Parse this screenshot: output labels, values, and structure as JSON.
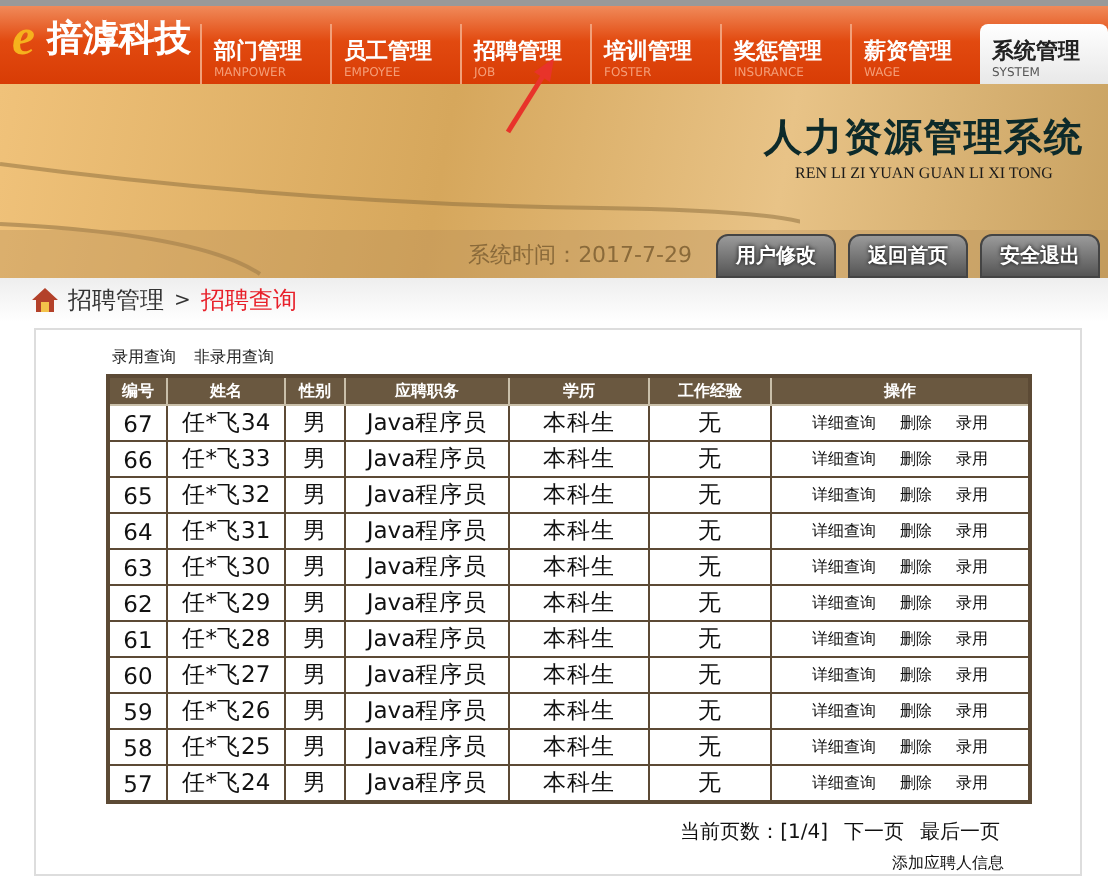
{
  "header": {
    "logo_letter": "e",
    "company": "揞滹科技",
    "nav": [
      {
        "label": "部门管理",
        "sub": "MANPOWER",
        "selected": false
      },
      {
        "label": "员工管理",
        "sub": "EMPOYEE",
        "selected": false
      },
      {
        "label": "招聘管理",
        "sub": "JOB",
        "selected": false
      },
      {
        "label": "培训管理",
        "sub": "FOSTER",
        "selected": false
      },
      {
        "label": "奖惩管理",
        "sub": "INSURANCE",
        "selected": false
      },
      {
        "label": "薪资管理",
        "sub": "WAGE",
        "selected": false
      },
      {
        "label": "系统管理",
        "sub": "SYSTEM",
        "selected": true
      }
    ]
  },
  "banner": {
    "title": "人力资源管理系统",
    "pinyin": "REN LI ZI YUAN GUAN LI XI TONG",
    "time": "系统时间：2017-7-29",
    "buttons": [
      "用户修改",
      "返回首页",
      "安全退出"
    ]
  },
  "breadcrumb": {
    "parent": "招聘管理",
    "separator": ">",
    "current": "招聘查询"
  },
  "filters": [
    "录用查询",
    "非录用查询"
  ],
  "table": {
    "columns": [
      "编号",
      "姓名",
      "性别",
      "应聘职务",
      "学历",
      "工作经验",
      "操作"
    ],
    "rows": [
      {
        "id": "67",
        "name": "任*飞34",
        "gender": "男",
        "job": "Java程序员",
        "education": "本科生",
        "experience": "无",
        "actions": [
          "详细查询",
          "删除",
          "录用"
        ]
      },
      {
        "id": "66",
        "name": "任*飞33",
        "gender": "男",
        "job": "Java程序员",
        "education": "本科生",
        "experience": "无",
        "actions": [
          "详细查询",
          "删除",
          "录用"
        ]
      },
      {
        "id": "65",
        "name": "任*飞32",
        "gender": "男",
        "job": "Java程序员",
        "education": "本科生",
        "experience": "无",
        "actions": [
          "详细查询",
          "删除",
          "录用"
        ]
      },
      {
        "id": "64",
        "name": "任*飞31",
        "gender": "男",
        "job": "Java程序员",
        "education": "本科生",
        "experience": "无",
        "actions": [
          "详细查询",
          "删除",
          "录用"
        ]
      },
      {
        "id": "63",
        "name": "任*飞30",
        "gender": "男",
        "job": "Java程序员",
        "education": "本科生",
        "experience": "无",
        "actions": [
          "详细查询",
          "删除",
          "录用"
        ]
      },
      {
        "id": "62",
        "name": "任*飞29",
        "gender": "男",
        "job": "Java程序员",
        "education": "本科生",
        "experience": "无",
        "actions": [
          "详细查询",
          "删除",
          "录用"
        ]
      },
      {
        "id": "61",
        "name": "任*飞28",
        "gender": "男",
        "job": "Java程序员",
        "education": "本科生",
        "experience": "无",
        "actions": [
          "详细查询",
          "删除",
          "录用"
        ]
      },
      {
        "id": "60",
        "name": "任*飞27",
        "gender": "男",
        "job": "Java程序员",
        "education": "本科生",
        "experience": "无",
        "actions": [
          "详细查询",
          "删除",
          "录用"
        ]
      },
      {
        "id": "59",
        "name": "任*飞26",
        "gender": "男",
        "job": "Java程序员",
        "education": "本科生",
        "experience": "无",
        "actions": [
          "详细查询",
          "删除",
          "录用"
        ]
      },
      {
        "id": "58",
        "name": "任*飞25",
        "gender": "男",
        "job": "Java程序员",
        "education": "本科生",
        "experience": "无",
        "actions": [
          "详细查询",
          "删除",
          "录用"
        ]
      },
      {
        "id": "57",
        "name": "任*飞24",
        "gender": "男",
        "job": "Java程序员",
        "education": "本科生",
        "experience": "无",
        "actions": [
          "详细查询",
          "删除",
          "录用"
        ]
      }
    ]
  },
  "pager": {
    "status": "当前页数：[1/4]",
    "links": [
      "下一页",
      "最后一页"
    ]
  },
  "add_link": "添加应聘人信息"
}
